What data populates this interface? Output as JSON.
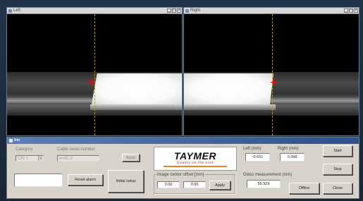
{
  "cameras": [
    {
      "title": "Left"
    },
    {
      "title": "Right"
    }
  ],
  "panel": {
    "title": "frm",
    "category_label": "Category",
    "category_value": "CAT 1",
    "serial_label": "Cable serial number",
    "serial_value": "testR_0",
    "apply_label": "Apply",
    "alarm_field_value": "",
    "reset_alarm_label": "Reset alarm",
    "initial_setup_label": "Initial setup",
    "logo_word": "TAYMER",
    "logo_tagline": "Quality on the Line",
    "offset_label": "Image center offset [mm]",
    "offset_x": "0.00",
    "offset_y": "0.00",
    "offset_apply_label": "Apply",
    "left_label": "Left (mm)",
    "left_value": "-0.531",
    "right_label": "Right (mm)",
    "right_value": "0.398",
    "glass_label": "Glass measurement (mm)",
    "glass_value": "55.929",
    "start_label": "Start",
    "stop_label": "Stop",
    "offline_label": "Offline",
    "close_label": "Close"
  }
}
